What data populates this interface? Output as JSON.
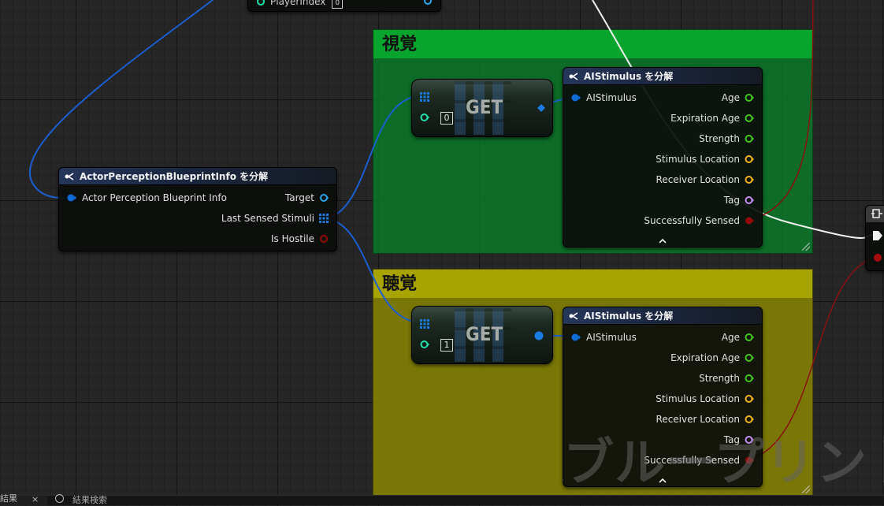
{
  "comments": {
    "sight": {
      "title": "視覚",
      "color": "#07a52d"
    },
    "hearing": {
      "title": "聴覚",
      "color": "#a7a300"
    }
  },
  "top_node": {
    "label": "PlayerIndex",
    "index": "0"
  },
  "actor_node": {
    "title": "ActorPerceptionBlueprintInfo を分解",
    "input": "Actor Perception Blueprint Info",
    "outputs": [
      "Target",
      "Last Sensed Stimuli",
      "Is Hostile"
    ]
  },
  "get_nodes": [
    {
      "label": "GET",
      "index": "0"
    },
    {
      "label": "GET",
      "index": "1"
    }
  ],
  "stimulus_nodes": [
    {
      "title": "AIStimulus を分解",
      "input": "AIStimulus",
      "outputs": [
        "Age",
        "Expiration Age",
        "Strength",
        "Stimulus Location",
        "Receiver Location",
        "Tag",
        "Successfully Sensed"
      ]
    },
    {
      "title": "AIStimulus を分解",
      "input": "AIStimulus",
      "outputs": [
        "Age",
        "Expiration Age",
        "Strength",
        "Stimulus Location",
        "Receiver Location",
        "Tag",
        "Successfully Sensed"
      ]
    }
  ],
  "watermark": "ブループリント",
  "bottom_bar": {
    "tab": "結果",
    "search": "結果検索"
  },
  "pin_colors": {
    "struct": "#0f6bd6",
    "float": "#43c71e",
    "vector": "#f2b31b",
    "name": "#c68ff7",
    "bool": "#950b0b",
    "object": "#26a8ef",
    "int": "#1fe0aa"
  },
  "icons": [
    "split-struct-icon",
    "array-grid-icon",
    "collapse-chevron-icon",
    "search-icon",
    "close-icon",
    "exec-pin-icon"
  ]
}
